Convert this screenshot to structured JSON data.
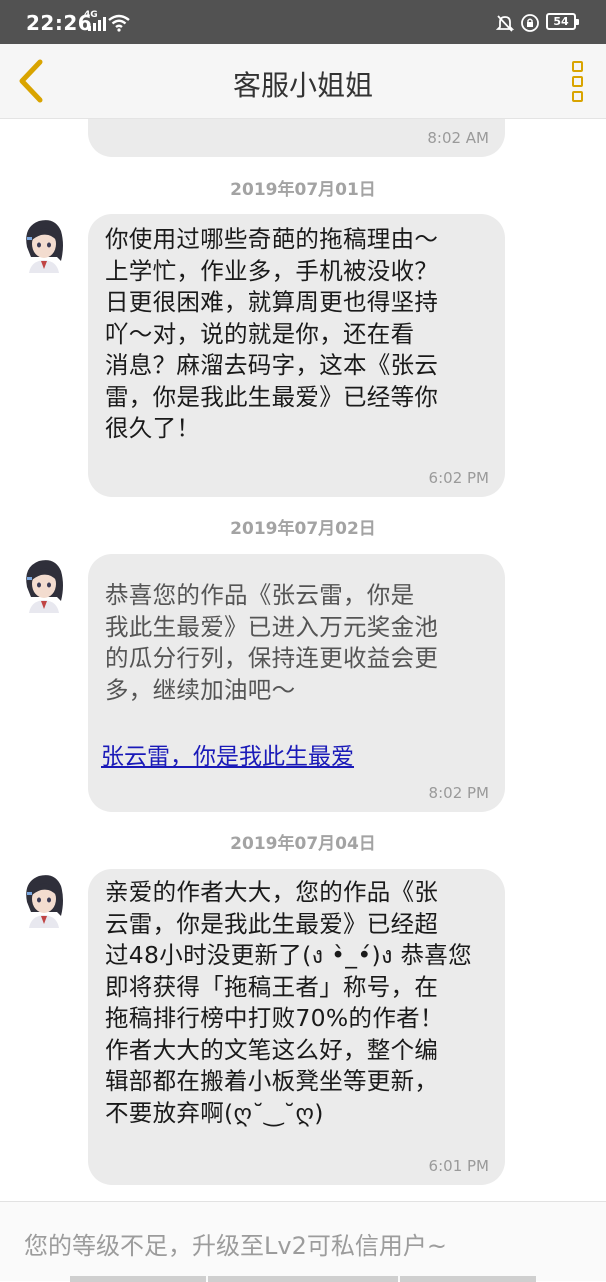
{
  "status_bar": {
    "time": "22:26",
    "signal_label": "4G",
    "battery": "54"
  },
  "header": {
    "title": "客服小姐姐"
  },
  "colors": {
    "accent": "#d9a400",
    "bubble": "#ebebeb",
    "link": "#1a1ab8"
  },
  "messages": [
    {
      "time": "8:02 AM"
    },
    {
      "date": "2019年07月01日",
      "text": "你使用过哪些奇葩的拖稿理由～\n上学忙，作业多，手机被没收？\n日更很困难，就算周更也得坚持\n吖～对，说的就是你，还在看\n消息？麻溜去码字，这本《张云\n雷，你是我此生最爱》已经等你\n很久了！",
      "time": "6:02 PM"
    },
    {
      "date": "2019年07月02日",
      "text": "恭喜您的作品《张云雷，你是\n我此生最爱》已进入万元奖金池\n的瓜分行列，保持连更收益会更\n多，继续加油吧～",
      "link": "张云雷，你是我此生最爱",
      "time": "8:02 PM"
    },
    {
      "date": "2019年07月04日",
      "text": "亲爱的作者大大，您的作品《张\n云雷，你是我此生最爱》已经超\n过48小时没更新了(ง •̀_•́)ง 恭喜您\n即将获得「拖稿王者」称号，在\n拖稿排行榜中打败70%的作者！\n作者大大的文笔这么好，整个编\n辑部都在搬着小板凳坐等更新，\n不要放弃啊(ღ˘‿˘ღ)",
      "time": "6:01 PM"
    }
  ],
  "input": {
    "hint": "您的等级不足，升级至Lv2可私信用户~"
  }
}
